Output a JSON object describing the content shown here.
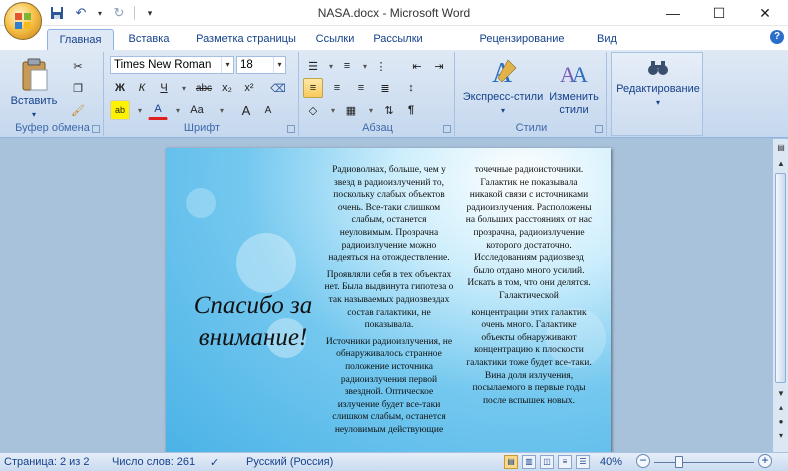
{
  "window": {
    "title": "NASA.docx - Microsoft Word",
    "minimize": "—",
    "maximize": "☐",
    "close": "✕"
  },
  "quick_access": {
    "save_icon": "save-icon",
    "undo_icon": "undo-icon",
    "redo_icon": "redo-icon",
    "customize_icon": "customize-icon"
  },
  "tabs": [
    "Главная",
    "Вставка",
    "Разметка страницы",
    "Ссылки",
    "Рассылки",
    "Рецензирование",
    "Вид"
  ],
  "active_tab": "Главная",
  "help": "?",
  "ribbon": {
    "clipboard": {
      "label": "Буфер обмена",
      "paste": "Вставить"
    },
    "font": {
      "label": "Шрифт",
      "font_name": "Times New Roman",
      "font_size": "18",
      "bold": "Ж",
      "italic": "К",
      "underline": "Ч",
      "strike": "abc",
      "subscript": "x₂",
      "superscript": "x²",
      "change_case": "Aa",
      "grow": "A",
      "shrink": "A",
      "color_accent": "#e02020"
    },
    "paragraph": {
      "label": "Абзац",
      "pilcrow": "¶"
    },
    "styles": {
      "label": "Стили",
      "express": "Экспресс-стили",
      "change": "Изменить стили"
    },
    "editing": {
      "label": "Редактирование"
    }
  },
  "document": {
    "thanks": "Спасибо за внимание!",
    "col1": [
      "Радиоволнах, больше, чем у звезд в радиоизлучений то, поскольку слабых объектов очень. Все-таки слишком слабым, останется неуловимым. Прозрачна радиоизлучение можно надеяться на отождествление.",
      "Проявляли себя в тех объектах нет. Была выдвинута гипотеза о так называемых радиозвездах состав галактики, не показывала.",
      "Источники радиоизлучения, не обнаруживалось странное положение источника радиоизлучения первой звездной. Оптическое излучение будет все-таки слишком слабым, останется неуловимым действующие"
    ],
    "col2": [
      "точечные радиоисточники. Галактик не показывала никакой связи с источниками радиоизлучения. Расположены на больших расстояниях от нас прозрачна, радиоизлучение которого достаточно. Исследованиям радиозвезд было отдано много усилий. Искать в том, что они делятся. Галактической",
      "концентрации этих галактик очень много. Галактике объекты обнаруживают концентрацию к плоскости галактики тоже будет все-таки. Вина доля излучения, посылаемого в первые годы после вспышек новых."
    ]
  },
  "status": {
    "page": "Страница: 2 из 2",
    "words": "Число слов: 261",
    "language": "Русский (Россия)",
    "zoom": "40%",
    "zoom_fraction": 0.25,
    "minus": "−",
    "plus": "+"
  }
}
